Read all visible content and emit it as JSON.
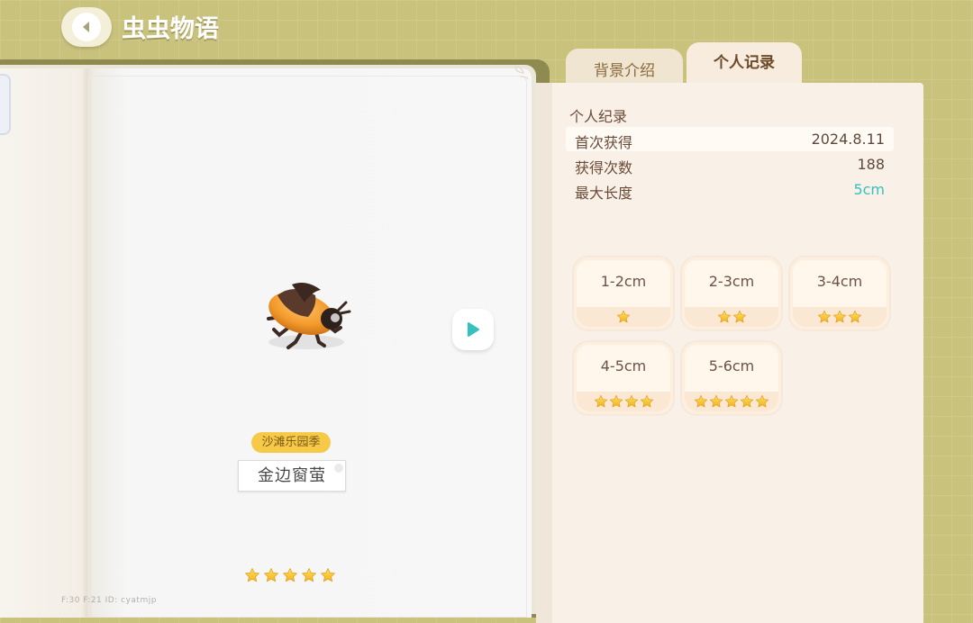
{
  "header": {
    "title": "虫虫物语"
  },
  "book": {
    "insect_name": "金边窗萤",
    "season_tag": "沙滩乐园季",
    "rarity_stars": 5,
    "debug_text": "F:30   F:21   ID: cyatmjp"
  },
  "tabs": [
    {
      "label": "背景介绍",
      "active": false
    },
    {
      "label": "个人记录",
      "active": true
    }
  ],
  "record": {
    "section_title": "个人纪录",
    "rows": [
      {
        "label": "首次获得",
        "value": "2024.8.11"
      },
      {
        "label": "获得次数",
        "value": "188"
      },
      {
        "label": "最大长度",
        "value": "5cm"
      }
    ]
  },
  "size_tiers": [
    {
      "label": "1-2cm",
      "stars": 1
    },
    {
      "label": "2-3cm",
      "stars": 2
    },
    {
      "label": "3-4cm",
      "stars": 3
    },
    {
      "label": "4-5cm",
      "stars": 4
    },
    {
      "label": "5-6cm",
      "stars": 5
    }
  ],
  "colors": {
    "accent_teal": "#35c1bf",
    "star_gold": "#f7c52b",
    "badge_yellow": "#f7c948"
  },
  "icons": {
    "back": "chevron-left-icon",
    "next": "play-right-icon",
    "star": "star-icon"
  }
}
